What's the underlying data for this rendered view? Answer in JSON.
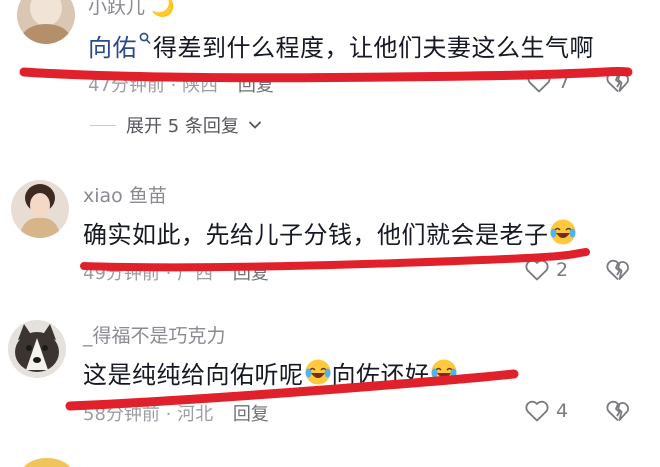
{
  "comments": [
    {
      "username": "小跃儿",
      "mention": "向佑",
      "text": "得差到什么程度，让他们夫妻这么生气啊",
      "time": "47分钟前",
      "location": "陕西",
      "reply_label": "回复",
      "likes": "7"
    },
    {
      "username": "xiao 鱼苗",
      "text": "确实如此，先给儿子分钱，他们就会是老子",
      "time": "49分钟前",
      "location": "广西",
      "reply_label": "回复",
      "likes": "2"
    },
    {
      "username": "_得福不是巧克力",
      "text_part1": "这是纯纯给向佑听呢",
      "text_part2": "向佐还好",
      "time": "58分钟前",
      "location": "河北",
      "reply_label": "回复",
      "likes": "4"
    }
  ],
  "expand": {
    "label": "展开 5 条回复"
  },
  "colors": {
    "annotation": "#e0202a",
    "mention": "#2b4a8b",
    "secondary_text": "#9c9ca3"
  },
  "icons": [
    "search-icon",
    "heart-icon",
    "broken-heart-icon",
    "chevron-down-icon",
    "laughing-crying-emoji"
  ]
}
